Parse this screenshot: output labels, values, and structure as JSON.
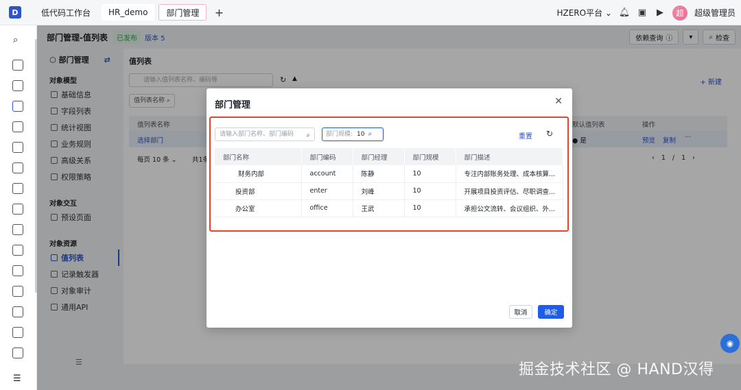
{
  "topbar": {
    "tabs": [
      {
        "label": "低代码工作台"
      },
      {
        "label": "HR_demo"
      },
      {
        "label": "部门管理"
      }
    ],
    "platform": "HZERO平台",
    "avatar_char": "超",
    "username": "超级管理员"
  },
  "pagebar": {
    "title": "部门管理-值列表",
    "status": "已发布",
    "version": "版本 5",
    "dep_query": "依赖查询",
    "check": "检查"
  },
  "leftnav": {
    "head": "部门管理",
    "sections": [
      {
        "title": "对象模型",
        "items": [
          "基础信息",
          "字段列表",
          "统计视图",
          "业务规则",
          "高级关系",
          "权限策略"
        ]
      },
      {
        "title": "对象交互",
        "items": [
          "预设页面"
        ]
      },
      {
        "title": "对象资源",
        "items": [
          "值列表",
          "记录触发器",
          "对象审计",
          "通用API"
        ]
      }
    ],
    "active_item": "值列表"
  },
  "main": {
    "title": "值列表",
    "search_placeholder": "请输入值列表名称、编码等",
    "new_label": "新建",
    "filter_chip": "值列表名称",
    "col_name": "值列表名称",
    "col_default": "默认值列表",
    "col_actions": "操作",
    "row_name": "选择部门",
    "row_default": "是",
    "row_preview": "预览",
    "row_copy": "复制",
    "row_more": "···",
    "page_size": "每页 10 条",
    "total": "共1条",
    "page_current": "1",
    "page_total": "1"
  },
  "modal": {
    "title": "部门管理",
    "search_placeholder": "请输入部门名称、部门编码",
    "scale_label": "部门规模:",
    "scale_value": "10",
    "reset": "重置",
    "columns": [
      "部门名称",
      "部门编码",
      "部门经理",
      "部门规模",
      "部门描述"
    ],
    "rows": [
      [
        "财务内部",
        "account",
        "陈静",
        "10",
        "专注内部账务处理、成本核算..."
      ],
      [
        "投资部",
        "enter",
        "刘峰",
        "10",
        "开展项目投资评估、尽职调查..."
      ],
      [
        "办公室",
        "office",
        "王武",
        "10",
        "承担公文流转、会议组织、外..."
      ]
    ],
    "cancel": "取消",
    "ok": "确定"
  },
  "watermark": "掘金技术社区 @ HAND汉得",
  "colors": {
    "primary": "#1f5ce8",
    "highlight": "#e4452b"
  }
}
